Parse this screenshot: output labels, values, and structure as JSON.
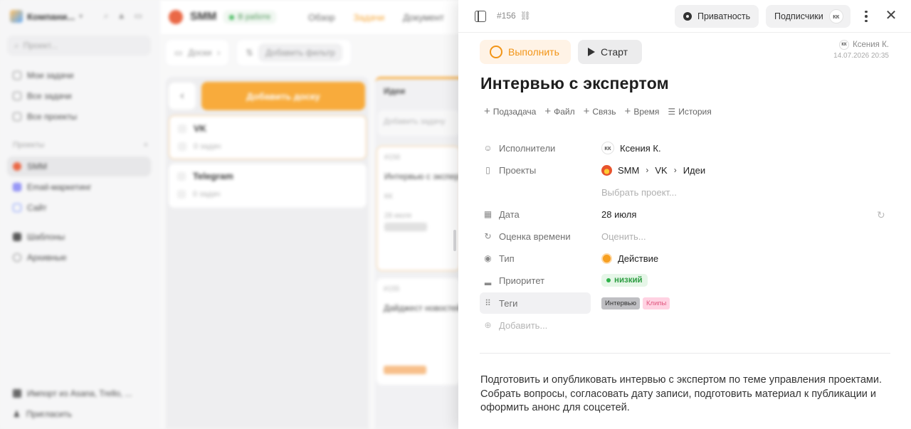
{
  "background": {
    "workspace": {
      "name": "Компани...",
      "search_placeholder": "Проект..."
    },
    "nav": [
      {
        "label": "Мои задачи"
      },
      {
        "label": "Все задачи"
      },
      {
        "label": "Все проекты"
      }
    ],
    "projects_section": {
      "title": "Проекты",
      "add": "+"
    },
    "projects": [
      {
        "label": "SMM",
        "active": true
      },
      {
        "label": "Email-маркетинг"
      },
      {
        "label": "Сайт"
      }
    ],
    "extra_nav": [
      {
        "label": "Шаблоны"
      },
      {
        "label": "Архивные"
      }
    ],
    "bottom": [
      {
        "label": "Импорт из Asana, Trello, ..."
      },
      {
        "label": "Пригласить"
      }
    ],
    "project_header": {
      "title": "SMM",
      "status": "В работе",
      "tabs": [
        {
          "label": "Обзор",
          "active": false
        },
        {
          "label": "Задачи",
          "active": true
        },
        {
          "label": "Документ",
          "active": false
        }
      ]
    },
    "filters": {
      "boards": "Доски",
      "add_filter": "Добавить фильтр"
    },
    "add_board": "Добавить доску",
    "boards": [
      {
        "title": "VK",
        "count": "0 задач",
        "selected": true
      },
      {
        "title": "Telegram",
        "count": "0 задач",
        "selected": false
      }
    ],
    "column": {
      "title": "Идеи",
      "add_task": "Добавить задачу",
      "cards": [
        {
          "num": "#156",
          "title": "Интервью с экспертом",
          "date": "28 июля",
          "assignee": "КК"
        },
        {
          "num": "#155",
          "title": "Дайджест новостей"
        }
      ]
    }
  },
  "task": {
    "number": "#156",
    "header_buttons": {
      "privacy": "Приватность",
      "subscribers": "Подписчики",
      "subscriber_initials": "КК"
    },
    "complete_label": "Выполнить",
    "start_label": "Старт",
    "creator": {
      "initials": "КК",
      "name": "Ксения К.",
      "date": "14.07.2026 20:35"
    },
    "title": "Интервью с экспертом",
    "actions": [
      {
        "label": "Подзадача",
        "icon": "plus-icon"
      },
      {
        "label": "Файл",
        "icon": "plus-icon"
      },
      {
        "label": "Связь",
        "icon": "plus-icon"
      },
      {
        "label": "Время",
        "icon": "plus-icon"
      },
      {
        "label": "История",
        "icon": "list-icon"
      }
    ],
    "fields": {
      "assignees": {
        "label": "Исполнители",
        "initials": "КК",
        "value": "Ксения К."
      },
      "projects": {
        "label": "Проекты",
        "path": [
          "SMM",
          "VK",
          "Идеи"
        ],
        "select_placeholder": "Выбрать проект..."
      },
      "date": {
        "label": "Дата",
        "value": "28 июля"
      },
      "estimate": {
        "label": "Оценка времени",
        "placeholder": "Оценить..."
      },
      "type": {
        "label": "Тип",
        "value": "Действие"
      },
      "priority": {
        "label": "Приоритет",
        "value": "низкий",
        "color": "#2fb24a"
      },
      "tags": {
        "label": "Теги",
        "values": [
          "Интервью",
          "Клипы"
        ]
      },
      "add_field": "Добавить..."
    },
    "description": "Подготовить и опубликовать интервью с экспертом по теме управления проектами. Собрать вопросы, согласовать дату записи, подготовить материал к публикации и оформить анонс для соцсетей.",
    "colors": {
      "accent": "#f29416",
      "priority_green": "#2e9e43"
    }
  }
}
